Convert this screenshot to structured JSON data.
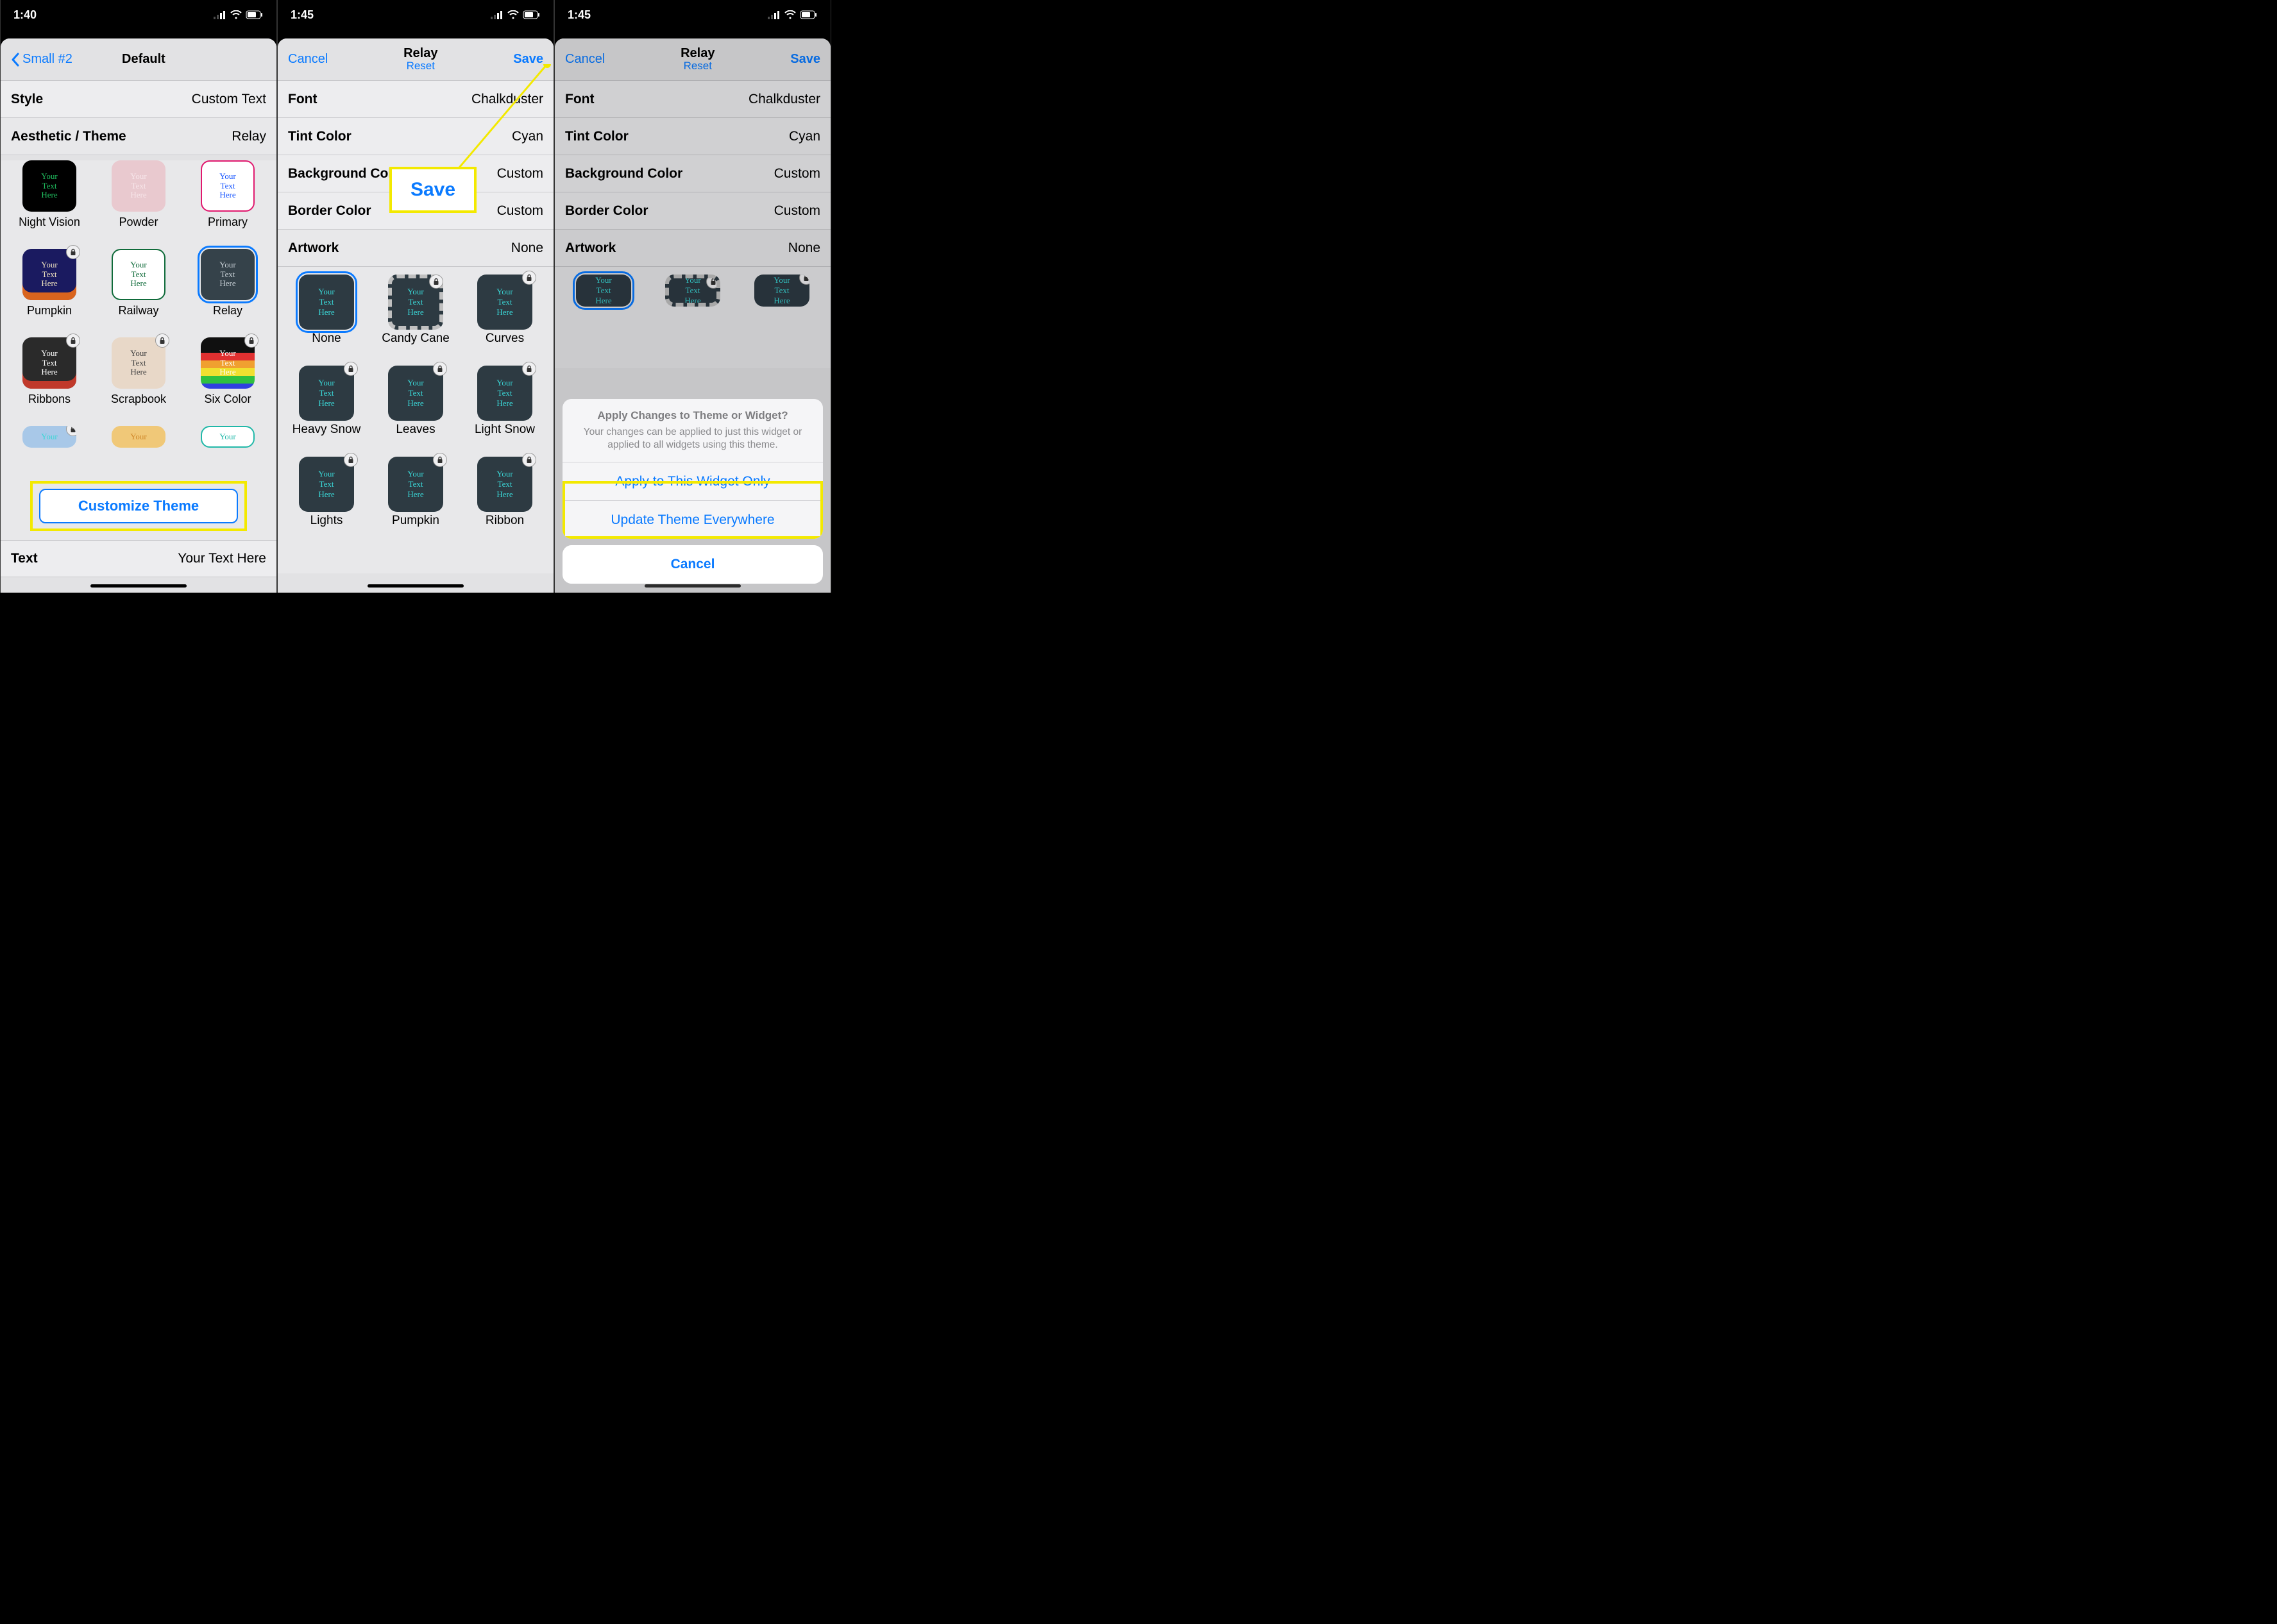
{
  "status": {
    "time1": "1:40",
    "time2": "1:45",
    "time3": "1:45"
  },
  "phone1": {
    "back_label": "Small #2",
    "title": "Default",
    "rows": {
      "style_label": "Style",
      "style_value": "Custom Text",
      "aesthetic_label": "Aesthetic / Theme",
      "aesthetic_value": "Relay",
      "text_label": "Text",
      "text_value": "Your Text Here"
    },
    "themes": [
      {
        "name": "Night Vision",
        "bg": "#000",
        "fg": "#20c060",
        "locked": false
      },
      {
        "name": "Powder",
        "bg": "#e9c9cf",
        "fg": "#f7e6ea",
        "locked": false
      },
      {
        "name": "Primary",
        "bg": "#fff",
        "fg": "#1050ff",
        "border": "#e0186e",
        "locked": false
      },
      {
        "name": "Pumpkin",
        "bg": "#1a1a60",
        "fg": "#f0e4c0",
        "locked": true,
        "accent": "#d9641e"
      },
      {
        "name": "Railway",
        "bg": "#fff",
        "fg": "#0f6b3a",
        "border": "#0f6b3a",
        "locked": false
      },
      {
        "name": "Relay",
        "bg": "#35424a",
        "fg": "#c8d0d6",
        "locked": false,
        "selected": true
      },
      {
        "name": "Ribbons",
        "bg": "#2a2a2a",
        "fg": "#fff",
        "locked": true,
        "accent": "#c0392b"
      },
      {
        "name": "Scrapbook",
        "bg": "#e8d8c8",
        "fg": "#404040",
        "locked": true
      },
      {
        "name": "Six Color",
        "bg": "#101010",
        "fg": "#fff",
        "locked": true,
        "rainbow": true
      }
    ],
    "themes_row4_peek": [
      {
        "name": "",
        "bg": "#a8c8e8",
        "fg": "#3ad6d6",
        "locked": true
      },
      {
        "name": "",
        "bg": "#f0c878",
        "fg": "#d0882a",
        "locked": false
      },
      {
        "name": "",
        "bg": "#fff",
        "fg": "#20b8a8",
        "border": "#20b8a8",
        "locked": false
      }
    ],
    "customize_btn": "Customize Theme",
    "placeholder_text": "Your Text Here"
  },
  "phone2": {
    "cancel": "Cancel",
    "title": "Relay",
    "reset": "Reset",
    "save": "Save",
    "callout": "Save",
    "rows": {
      "font_label": "Font",
      "font_value": "Chalkduster",
      "tint_label": "Tint Color",
      "tint_value": "Cyan",
      "bg_label": "Background Color",
      "bg_value": "Custom",
      "border_label": "Border Color",
      "border_value": "Custom",
      "artwork_label": "Artwork",
      "artwork_value": "None"
    },
    "art": [
      {
        "name": "None",
        "locked": false,
        "selected": true
      },
      {
        "name": "Candy Cane",
        "locked": true,
        "border": "stripes"
      },
      {
        "name": "Curves",
        "locked": true
      },
      {
        "name": "Heavy Snow",
        "locked": true
      },
      {
        "name": "Leaves",
        "locked": true
      },
      {
        "name": "Light Snow",
        "locked": true
      },
      {
        "name": "Lights",
        "locked": true
      },
      {
        "name": "Pumpkin",
        "locked": true
      },
      {
        "name": "Ribbon",
        "locked": true
      }
    ],
    "placeholder_text": "Your Text Here"
  },
  "phone3": {
    "cancel": "Cancel",
    "title": "Relay",
    "reset": "Reset",
    "save": "Save",
    "rows": {
      "font_label": "Font",
      "font_value": "Chalkduster",
      "tint_label": "Tint Color",
      "tint_value": "Cyan",
      "bg_label": "Background Color",
      "bg_value": "Custom",
      "border_label": "Border Color",
      "border_value": "Custom",
      "artwork_label": "Artwork",
      "artwork_value": "None"
    },
    "sheet": {
      "title": "Apply Changes to Theme or Widget?",
      "desc": "Your changes can be applied to just this widget or applied to all widgets using this theme.",
      "opt1": "Apply to This Widget Only",
      "opt2": "Update Theme Everywhere",
      "cancel": "Cancel"
    }
  }
}
